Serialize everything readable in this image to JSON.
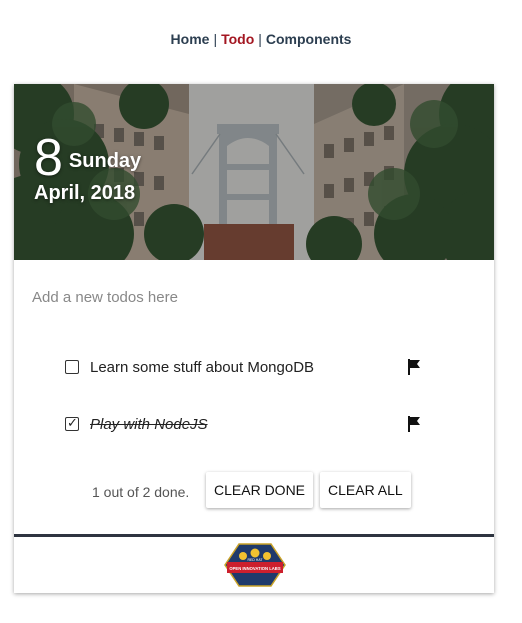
{
  "nav": {
    "home": "Home",
    "todo": "Todo",
    "components": "Components",
    "separator": "|"
  },
  "hero": {
    "day_number": "8",
    "weekday": "Sunday",
    "month_year": "April, 2018"
  },
  "new_todo": {
    "placeholder": "Add a new todos here",
    "value": ""
  },
  "todos": [
    {
      "label": "Learn some stuff about MongoDB",
      "done": false,
      "flag_icon": "flag-icon"
    },
    {
      "label": "Play with NodeJS",
      "done": true,
      "flag_icon": "flag-icon"
    }
  ],
  "summary": "1 out of 2 done.",
  "buttons": {
    "clear_done": "CLEAR DONE",
    "clear_all": "CLEAR ALL"
  },
  "colors": {
    "active_nav": "#a31621",
    "nav_text": "#2c3e50",
    "footer_bar": "#2e3440"
  },
  "logo": {
    "icon": "open-innovation-labs-logo",
    "tiny_text": "RED HAT",
    "text": "OPEN INNOVATION LABS"
  }
}
